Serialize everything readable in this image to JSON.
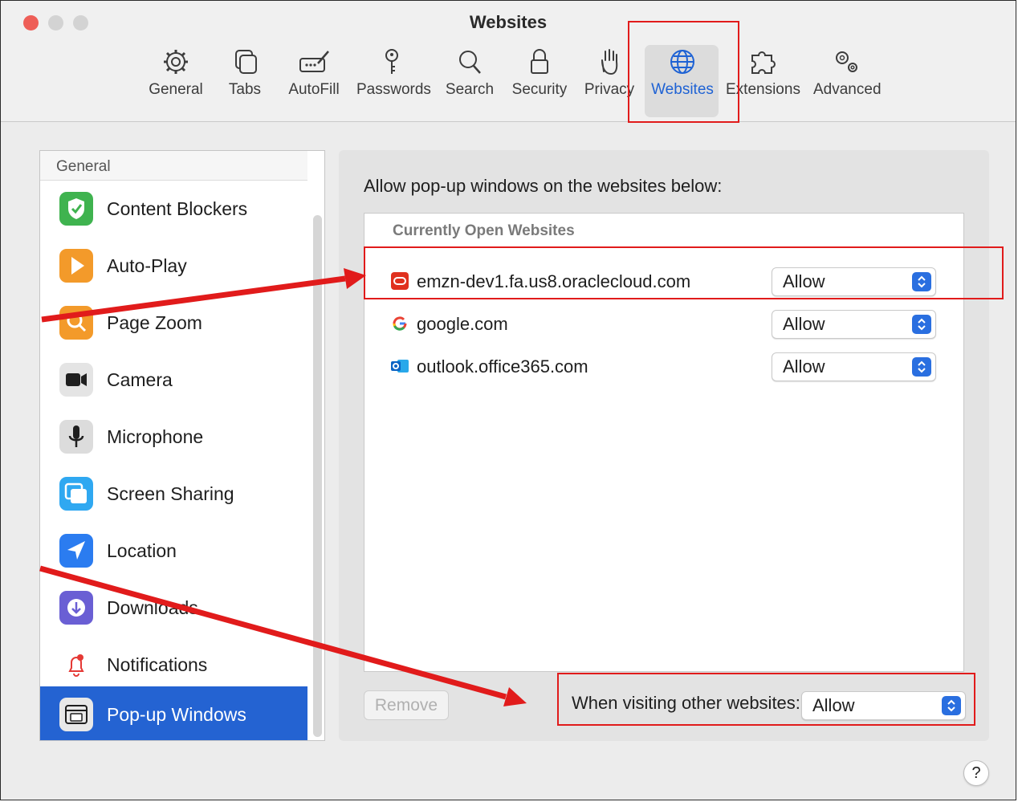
{
  "window": {
    "title": "Websites"
  },
  "toolbar": {
    "items": [
      {
        "label": "General",
        "icon": "gear-icon"
      },
      {
        "label": "Tabs",
        "icon": "tabs-icon"
      },
      {
        "label": "AutoFill",
        "icon": "autofill-icon"
      },
      {
        "label": "Passwords",
        "icon": "key-icon"
      },
      {
        "label": "Search",
        "icon": "magnifier-icon"
      },
      {
        "label": "Security",
        "icon": "lock-icon"
      },
      {
        "label": "Privacy",
        "icon": "hand-icon"
      },
      {
        "label": "Websites",
        "icon": "globe-icon",
        "selected": true
      },
      {
        "label": "Extensions",
        "icon": "puzzle-icon"
      },
      {
        "label": "Advanced",
        "icon": "gears-icon"
      }
    ],
    "accent": "#1e62d4"
  },
  "sidebar": {
    "header": "General",
    "items": [
      {
        "label": "Content Blockers",
        "icon": "shield-check-icon"
      },
      {
        "label": "Auto-Play",
        "icon": "play-icon"
      },
      {
        "label": "Page Zoom",
        "icon": "zoom-icon"
      },
      {
        "label": "Camera",
        "icon": "camera-icon"
      },
      {
        "label": "Microphone",
        "icon": "microphone-icon"
      },
      {
        "label": "Screen Sharing",
        "icon": "screen-sharing-icon"
      },
      {
        "label": "Location",
        "icon": "location-arrow-icon"
      },
      {
        "label": "Downloads",
        "icon": "download-icon"
      },
      {
        "label": "Notifications",
        "icon": "bell-icon"
      },
      {
        "label": "Pop-up Windows",
        "icon": "popup-window-icon",
        "selected": true
      }
    ],
    "selected_color": "#2463d2"
  },
  "main": {
    "heading": "Allow pop-up windows on the websites below:",
    "list_header": "Currently Open Websites",
    "sites": [
      {
        "name": "emzn-dev1.fa.us8.oraclecloud.com",
        "icon": "oracle-icon",
        "setting": "Allow"
      },
      {
        "name": "google.com",
        "icon": "google-icon",
        "setting": "Allow"
      },
      {
        "name": "outlook.office365.com",
        "icon": "outlook-icon",
        "setting": "Allow"
      }
    ],
    "remove_label": "Remove",
    "visiting_label": "When visiting other websites:",
    "visiting_value": "Allow",
    "help_label": "?"
  },
  "annotation": {
    "color": "#e11b1b"
  }
}
